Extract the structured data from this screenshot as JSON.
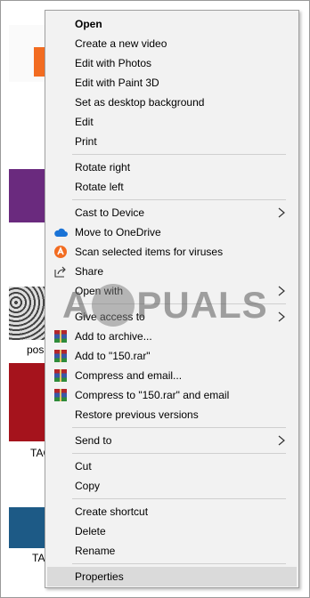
{
  "background": {
    "labels": [
      "pos",
      "TAC",
      "TA"
    ]
  },
  "menu": {
    "items": [
      {
        "label": "Open"
      },
      {
        "label": "Create a new video"
      },
      {
        "label": "Edit with Photos"
      },
      {
        "label": "Edit with Paint 3D"
      },
      {
        "label": "Set as desktop background"
      },
      {
        "label": "Edit"
      },
      {
        "label": "Print"
      },
      {
        "label": "Rotate right"
      },
      {
        "label": "Rotate left"
      },
      {
        "label": "Cast to Device"
      },
      {
        "label": "Move to OneDrive"
      },
      {
        "label": "Scan selected items for viruses"
      },
      {
        "label": "Share"
      },
      {
        "label": "Open with"
      },
      {
        "label": "Give access to"
      },
      {
        "label": "Add to archive..."
      },
      {
        "label": "Add to \"150.rar\""
      },
      {
        "label": "Compress and email..."
      },
      {
        "label": "Compress to \"150.rar\" and email"
      },
      {
        "label": "Restore previous versions"
      },
      {
        "label": "Send to"
      },
      {
        "label": "Cut"
      },
      {
        "label": "Copy"
      },
      {
        "label": "Create shortcut"
      },
      {
        "label": "Delete"
      },
      {
        "label": "Rename"
      },
      {
        "label": "Properties"
      }
    ]
  },
  "watermark": {
    "left": "A",
    "right": "PUALS"
  },
  "colors": {
    "menu_bg": "#f2f2f2",
    "hover_bg": "#dadada",
    "onedrive_blue": "#1a73d6",
    "avast_orange": "#f26c21",
    "winrar_red": "#b3262b"
  },
  "icons": {
    "onedrive": "onedrive-cloud-icon",
    "scan": "avast-icon",
    "share": "share-icon",
    "winrar": "winrar-icon",
    "submenu": "chevron-right-icon"
  }
}
